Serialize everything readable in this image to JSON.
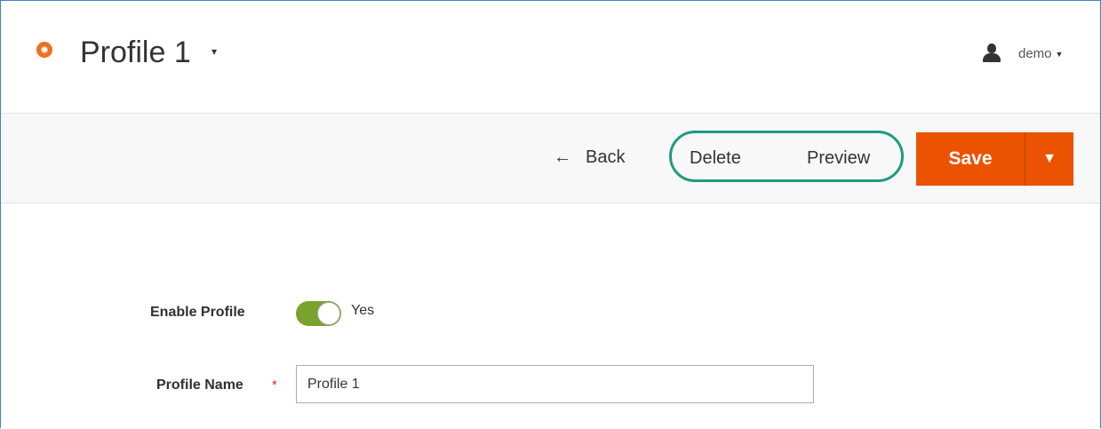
{
  "header": {
    "title": "Profile 1",
    "title_caret": "▾",
    "user_name": "demo",
    "user_caret": "▼"
  },
  "actions": {
    "back_label": "Back",
    "back_icon": "←",
    "delete_label": "Delete",
    "preview_label": "Preview",
    "save_label": "Save",
    "save_toggle_icon": "▼"
  },
  "form": {
    "enable_label": "Enable Profile",
    "enable_value": "Yes",
    "enable_state": true,
    "name_label": "Profile Name",
    "required_marker": "*",
    "name_value": "Profile 1"
  },
  "colors": {
    "accent": "#eb5202",
    "logo": "#f0701f",
    "toggle_on": "#79a22e",
    "highlight": "#1f9a7e",
    "required": "#e22626"
  }
}
